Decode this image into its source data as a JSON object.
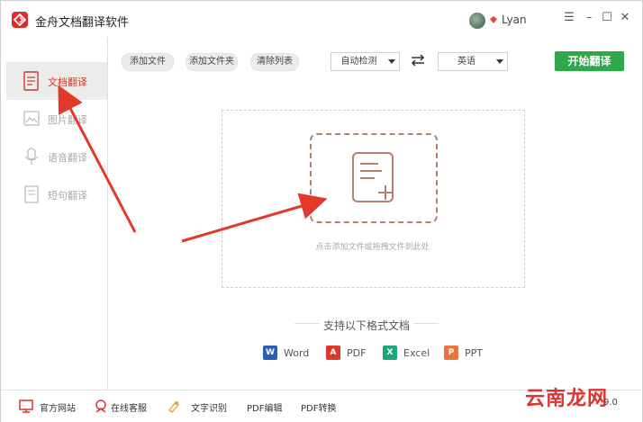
{
  "titlebar": {
    "app_title": "金舟文档翻译软件",
    "username": "Lyan"
  },
  "sidebar": {
    "items": [
      {
        "label": "文档翻译",
        "icon": "document-icon"
      },
      {
        "label": "图片翻译",
        "icon": "image-icon"
      },
      {
        "label": "语音翻译",
        "icon": "microphone-icon"
      },
      {
        "label": "短句翻译",
        "icon": "sentence-icon"
      }
    ]
  },
  "toolbar": {
    "add_file": "添加文件",
    "add_folder": "添加文件夹",
    "clear_list": "清除列表",
    "source_lang": "自动检测",
    "target_lang": "英语",
    "start": "开始翻译"
  },
  "dropzone": {
    "hint": "点击添加文件或拖拽文件到此处"
  },
  "formats": {
    "title": "支持以下格式文档",
    "items": [
      "Word",
      "PDF",
      "Excel",
      "PPT"
    ]
  },
  "bottombar": {
    "official_site": "官方网站",
    "online_service": "在线客服",
    "ocr": "文字识别",
    "pdf_edit": "PDF编辑",
    "pdf_convert": "PDF转换",
    "version_suffix": "9.0"
  },
  "watermark": "云南龙网",
  "colors": {
    "accent": "#c83a2c",
    "start_button": "#2fa84b",
    "annotation_arrow": "#e23a2a"
  }
}
